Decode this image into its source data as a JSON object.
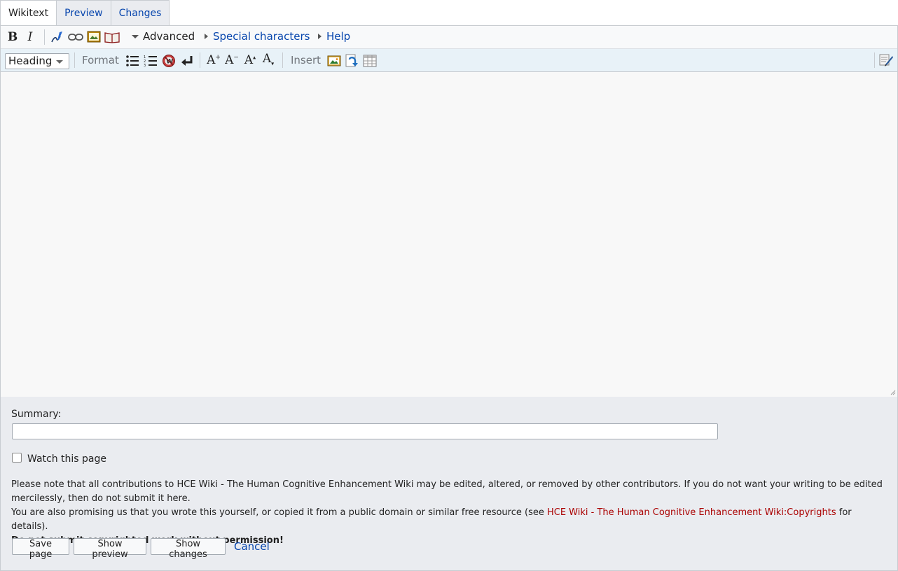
{
  "tabs": [
    {
      "label": "Wikitext",
      "active": true
    },
    {
      "label": "Preview",
      "active": false
    },
    {
      "label": "Changes",
      "active": false
    }
  ],
  "toolbar": {
    "groups": {
      "advanced": "Advanced",
      "special_characters": "Special characters",
      "help": "Help"
    },
    "main_tools": [
      "bold-icon",
      "italic-icon",
      "signature-icon",
      "link-icon",
      "embedded-file-icon",
      "reference-icon"
    ],
    "heading_select": "Heading",
    "format_label": "Format",
    "format_tools": [
      "bulleted-list-icon",
      "numbered-list-icon",
      "no-wiki-icon",
      "newline-icon",
      "big-text-icon",
      "small-text-icon",
      "superscript-icon",
      "subscript-icon"
    ],
    "insert_label": "Insert",
    "insert_tools": [
      "gallery-icon",
      "redirect-icon",
      "table-icon"
    ],
    "search_replace": "search-replace-icon"
  },
  "editor": {
    "content": ""
  },
  "options": {
    "summary_label": "Summary:",
    "summary_value": "",
    "watch_label": "Watch this page",
    "watch_checked": false,
    "notice_1": "Please note that all contributions to HCE Wiki - The Human Cognitive Enhancement Wiki may be edited, altered, or removed by other contributors. If you do not want your writing to be edited mercilessly, then do not submit it here.",
    "notice_2_before": "You are also promising us that you wrote this yourself, or copied it from a public domain or similar free resource (see ",
    "notice_2_link": "HCE Wiki - The Human Cognitive Enhancement Wiki:Copyrights",
    "notice_2_after": " for details).",
    "notice_3": "Do not submit copyrighted work without permission!",
    "buttons": {
      "save": "Save page",
      "preview": "Show preview",
      "changes": "Show changes",
      "cancel": "Cancel"
    }
  },
  "colors": {
    "link": "#0645ad",
    "red_link": "#aa0000",
    "toolbar_advanced_bg": "#e8f2f8",
    "options_bg": "#eaecf0"
  }
}
